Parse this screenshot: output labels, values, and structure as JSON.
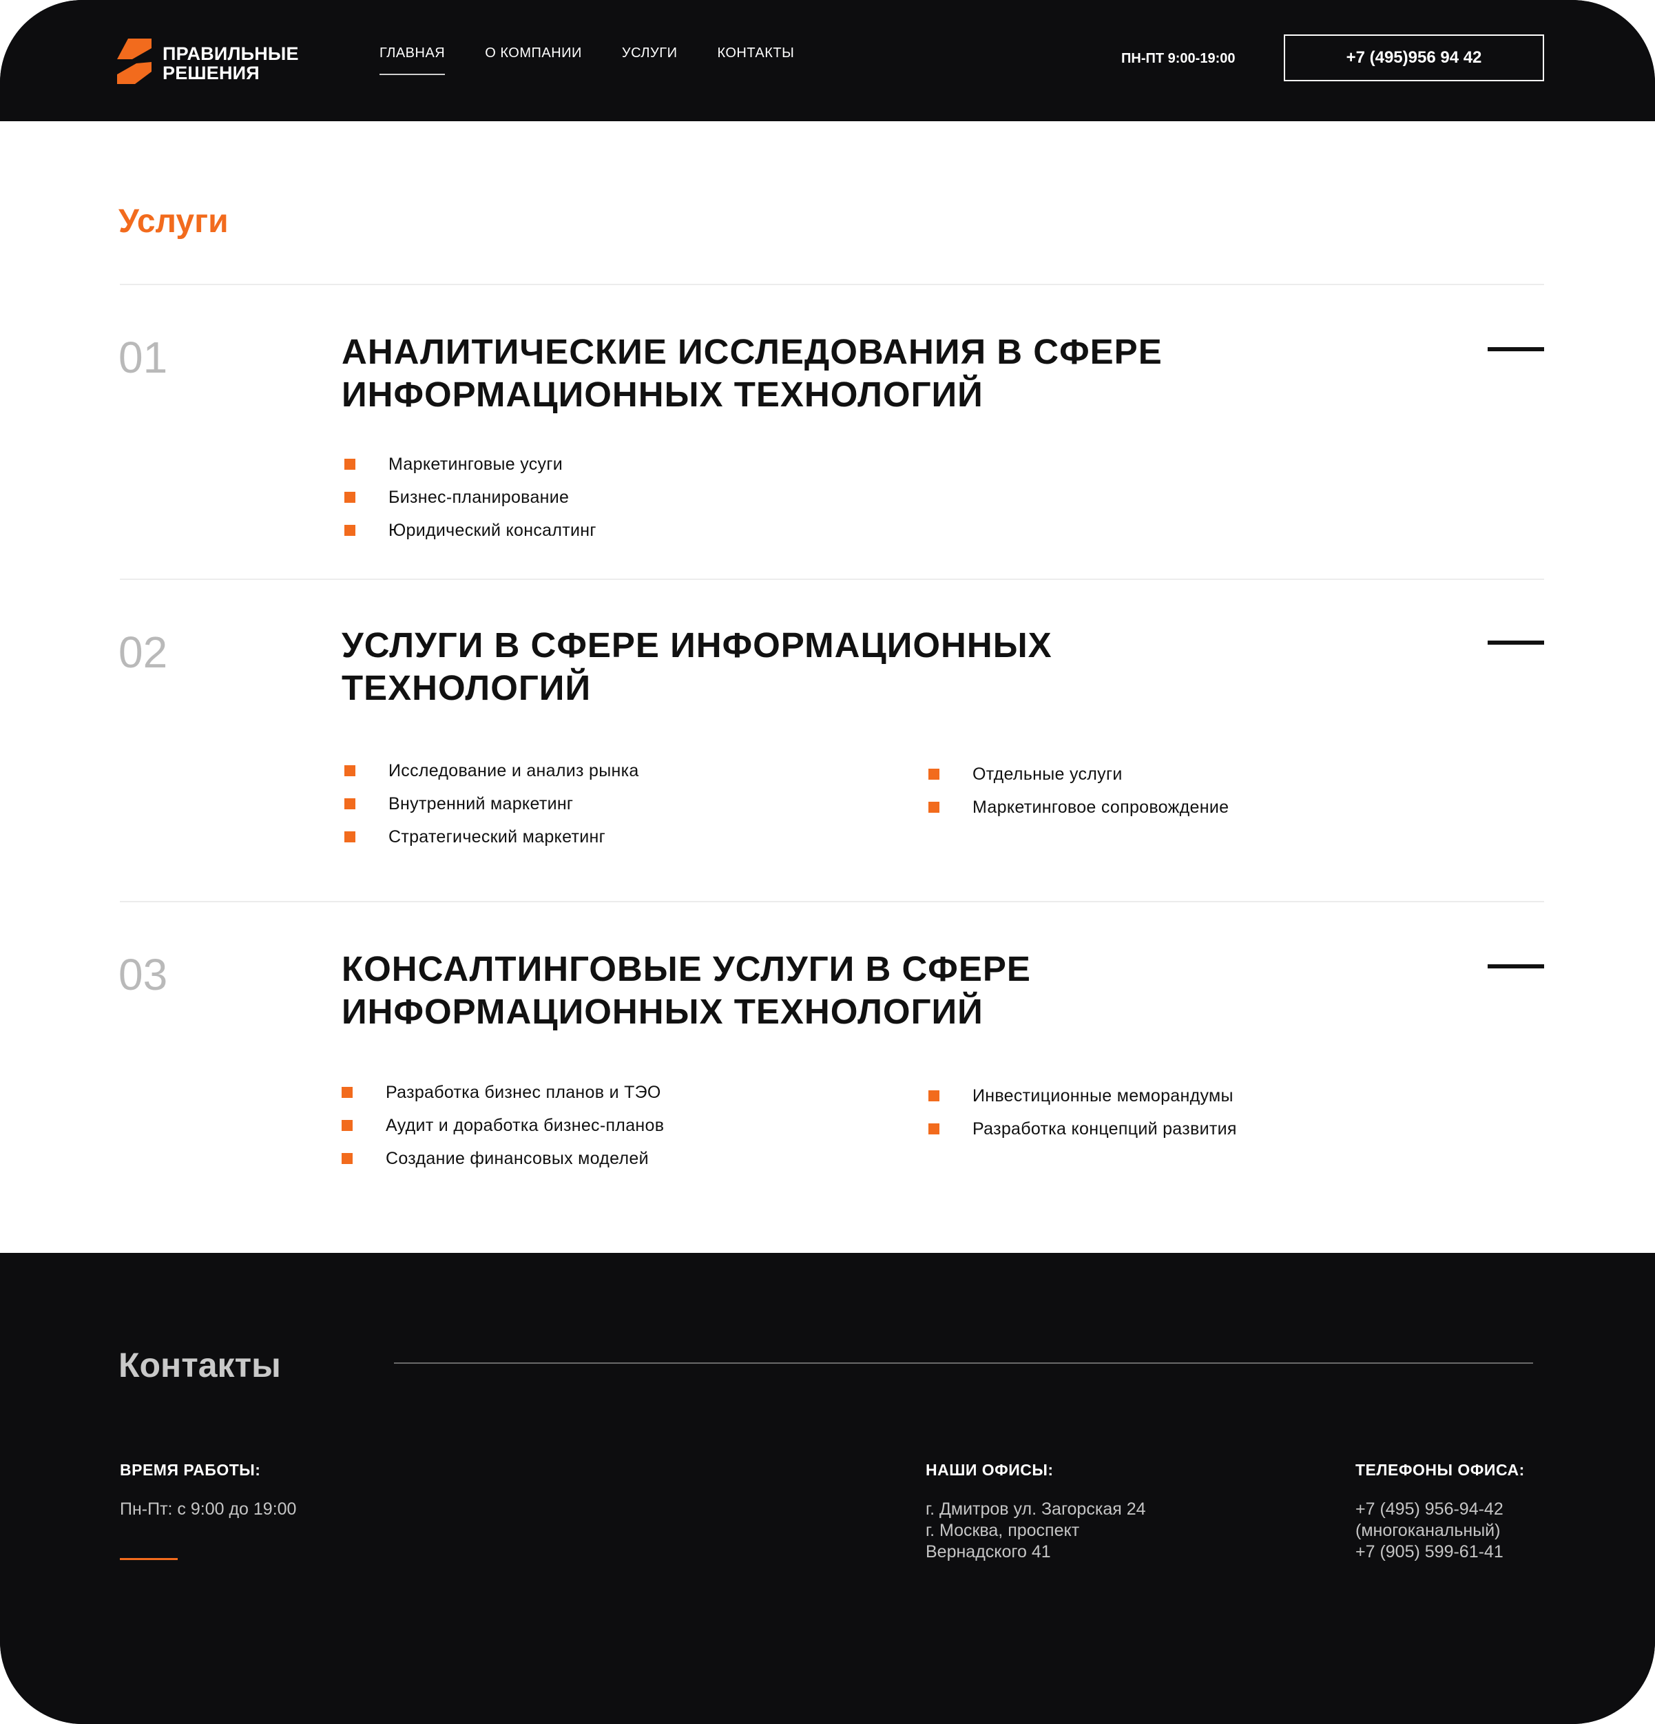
{
  "header": {
    "logo": {
      "line1": "ПРАВИЛЬНЫЕ",
      "line2": "РЕШЕНИЯ"
    },
    "nav": [
      {
        "label": "ГЛАВНАЯ",
        "active": true
      },
      {
        "label": "О КОМПАНИИ",
        "active": false
      },
      {
        "label": "УСЛУГИ",
        "active": false
      },
      {
        "label": "КОНТАКТЫ",
        "active": false
      }
    ],
    "hours": "ПН-ПТ 9:00-19:00",
    "phone": "+7 (495)956 94 42"
  },
  "main": {
    "title": "Услуги",
    "services": [
      {
        "number": "01",
        "title": "АНАЛИТИЧЕСКИЕ ИССЛЕДОВАНИЯ В СФЕРЕ ИНФОРМАЦИОННЫХ ТЕХНОЛОГИЙ",
        "col1": [
          "Маркетинговые усуги",
          "Бизнес-планирование",
          "Юридический консалтинг"
        ],
        "col2": []
      },
      {
        "number": "02",
        "title": "УСЛУГИ В СФЕРЕ ИНФОРМАЦИОННЫХ ТЕХНОЛОГИЙ",
        "col1": [
          "Исследование и анализ рынка",
          "Внутренний маркетинг",
          "Стратегический маркетинг"
        ],
        "col2": [
          "Отдельные услуги",
          "Маркетинговое сопровождение"
        ]
      },
      {
        "number": "03",
        "title": "КОНСАЛТИНГОВЫЕ УСЛУГИ В СФЕРЕ ИНФОРМАЦИОННЫХ ТЕХНОЛОГИЙ",
        "col1": [
          "Разработка бизнес планов и ТЭО",
          "Аудит и доработка бизнес-планов",
          "Создание финансовых моделей"
        ],
        "col2": [
          "Инвестиционные меморандумы",
          "Разработка концепций развития"
        ]
      }
    ]
  },
  "footer": {
    "title": "Контакты",
    "work_time": {
      "heading": "ВРЕМЯ РАБОТЫ:",
      "text": "Пн-Пт: с 9:00 до 19:00"
    },
    "offices": {
      "heading": "НАШИ ОФИСЫ:",
      "lines": [
        "г. Дмитров ул. Загорская 24",
        "г. Москва, проспект",
        "Вернадского 41"
      ]
    },
    "phones": {
      "heading": "ТЕЛЕФОНЫ ОФИСА:",
      "lines": [
        "+7 (495) 956-94-42",
        "(многоканальный)",
        "+7 (905) 599-61-41"
      ]
    }
  },
  "colors": {
    "accent": "#f26b1d",
    "dark": "#0d0d0f",
    "muted_number": "#b9b9b9"
  }
}
